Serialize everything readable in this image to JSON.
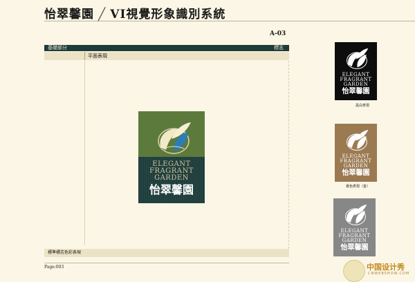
{
  "header": {
    "brand": "怡翠馨園",
    "section": "VI視覺形象識別系統",
    "page_code": "A-03"
  },
  "table": {
    "category": "基礎部分",
    "item": "標志",
    "row_label": "平面表現",
    "bottom_label": "標準標志色彩表現"
  },
  "logo": {
    "line1": "ELEGANT",
    "line2": "FRAGRANT",
    "line3": "GARDEN",
    "chinese": "怡翠馨園"
  },
  "variants": [
    {
      "caption": "黑白表現"
    },
    {
      "caption": "專色表現（金）"
    },
    {
      "caption": ""
    }
  ],
  "footer": {
    "page": "Page:003"
  },
  "watermark": {
    "name": "中国设计秀",
    "domain": "CNWEBSHOW.COM"
  },
  "colors": {
    "background": "#fcf6e6",
    "dark_green": "#1f3d3a",
    "olive": "#5c7a3c",
    "gold": "#9b7a52",
    "gray": "#878787"
  }
}
